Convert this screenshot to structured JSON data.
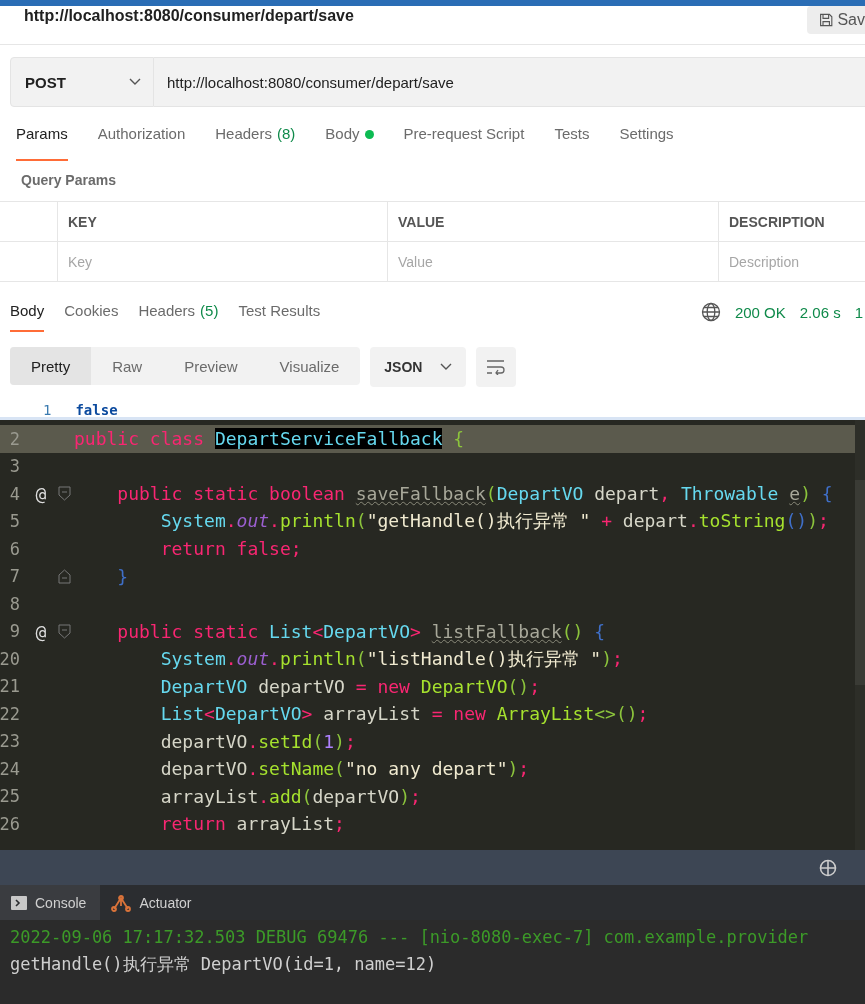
{
  "request": {
    "title": "http://localhost:8080/consumer/depart/save",
    "save_label": "Sav",
    "method": "POST",
    "url": "http://localhost:8080/consumer/depart/save",
    "tabs": [
      {
        "label": "Params",
        "selected": true,
        "dot": false
      },
      {
        "label": "Authorization",
        "selected": false,
        "dot": false
      },
      {
        "label": "Headers",
        "count": "(8)",
        "selected": false,
        "dot": false
      },
      {
        "label": "Body",
        "selected": false,
        "dot": true
      },
      {
        "label": "Pre-request Script",
        "selected": false,
        "dot": false
      },
      {
        "label": "Tests",
        "selected": false,
        "dot": false
      },
      {
        "label": "Settings",
        "selected": false,
        "dot": false
      }
    ],
    "section_title": "Query Params",
    "columns": [
      "KEY",
      "VALUE",
      "DESCRIPTION"
    ],
    "placeholders": [
      "Key",
      "Value",
      "Description"
    ]
  },
  "response": {
    "tabs": [
      {
        "label": "Body",
        "selected": true
      },
      {
        "label": "Cookies",
        "selected": false
      },
      {
        "label": "Headers",
        "count": "(5)",
        "selected": false
      },
      {
        "label": "Test Results",
        "selected": false
      }
    ],
    "status": "200 OK",
    "time": "2.06 s",
    "size": "1",
    "views": [
      {
        "label": "Pretty",
        "selected": true
      },
      {
        "label": "Raw",
        "selected": false
      },
      {
        "label": "Preview",
        "selected": false
      },
      {
        "label": "Visualize",
        "selected": false
      }
    ],
    "format": "JSON",
    "lines": [
      {
        "number": "1",
        "value": "false"
      }
    ]
  },
  "editor": {
    "lines": [
      {
        "number": "2",
        "current": true,
        "tokens": [
          {
            "kind": "kw",
            "text": "public class "
          },
          {
            "kind": "match",
            "text": "DepartServiceFallback"
          },
          {
            "kind": "paren",
            "text": " {"
          }
        ]
      },
      {
        "number": "3",
        "current": false
      },
      {
        "number": "4",
        "mark": "@",
        "fold": {
          "kind": "start"
        },
        "current": false,
        "tokens": [
          {
            "kind": "kw",
            "text": "    public static boolean "
          },
          {
            "kind": "unused",
            "text": "saveFallback"
          },
          {
            "kind": "paren",
            "text": "("
          },
          {
            "kind": "type",
            "text": "DepartVO"
          },
          {
            "kind": "plain",
            "text": " depart"
          },
          {
            "kind": "punct",
            "text": ", "
          },
          {
            "kind": "type",
            "text": "Throwable "
          },
          {
            "kind": "unused",
            "text": "e"
          },
          {
            "kind": "paren",
            "text": ")"
          },
          {
            "kind": "brace",
            "text": " {"
          }
        ]
      },
      {
        "number": "5",
        "current": false,
        "tokens": [
          {
            "kind": "type",
            "text": "        System"
          },
          {
            "kind": "punct",
            "text": "."
          },
          {
            "kind": "field",
            "text": "out"
          },
          {
            "kind": "punct",
            "text": "."
          },
          {
            "kind": "fn",
            "text": "println"
          },
          {
            "kind": "paren",
            "text": "("
          },
          {
            "kind": "str",
            "text": "\"getHandle()执行异常 \""
          },
          {
            "kind": "punct",
            "text": " + "
          },
          {
            "kind": "plain",
            "text": "depart"
          },
          {
            "kind": "punct",
            "text": "."
          },
          {
            "kind": "fn",
            "text": "toString"
          },
          {
            "kind": "brace",
            "text": "()"
          },
          {
            "kind": "paren",
            "text": ")"
          },
          {
            "kind": "punct",
            "text": ";"
          }
        ]
      },
      {
        "number": "6",
        "current": false,
        "tokens": [
          {
            "kind": "kw",
            "text": "        return false"
          },
          {
            "kind": "punct",
            "text": ";"
          }
        ]
      },
      {
        "number": "7",
        "fold": {
          "kind": "end"
        },
        "current": false,
        "tokens": [
          {
            "kind": "brace",
            "text": "    }"
          }
        ]
      },
      {
        "number": "8",
        "current": false
      },
      {
        "number": "9",
        "mark": "@",
        "fold": {
          "kind": "start"
        },
        "current": false,
        "tokens": [
          {
            "kind": "kw",
            "text": "    public static "
          },
          {
            "kind": "type",
            "text": "List"
          },
          {
            "kind": "punct",
            "text": "<"
          },
          {
            "kind": "type",
            "text": "DepartVO"
          },
          {
            "kind": "punct",
            "text": "> "
          },
          {
            "kind": "unused",
            "text": "listFallback"
          },
          {
            "kind": "paren",
            "text": "()"
          },
          {
            "kind": "brace",
            "text": " {"
          }
        ]
      },
      {
        "number": "20",
        "current": false,
        "tokens": [
          {
            "kind": "type",
            "text": "        System"
          },
          {
            "kind": "punct",
            "text": "."
          },
          {
            "kind": "field",
            "text": "out"
          },
          {
            "kind": "punct",
            "text": "."
          },
          {
            "kind": "fn",
            "text": "println"
          },
          {
            "kind": "paren",
            "text": "("
          },
          {
            "kind": "str",
            "text": "\"listHandle()执行异常 \""
          },
          {
            "kind": "paren",
            "text": ")"
          },
          {
            "kind": "punct",
            "text": ";"
          }
        ]
      },
      {
        "number": "21",
        "current": false,
        "tokens": [
          {
            "kind": "type",
            "text": "        DepartVO"
          },
          {
            "kind": "plain",
            "text": " departVO "
          },
          {
            "kind": "kw",
            "text": "= new "
          },
          {
            "kind": "fn",
            "text": "DepartVO"
          },
          {
            "kind": "paren",
            "text": "()"
          },
          {
            "kind": "punct",
            "text": ";"
          }
        ]
      },
      {
        "number": "22",
        "current": false,
        "tokens": [
          {
            "kind": "type",
            "text": "        List"
          },
          {
            "kind": "punct",
            "text": "<"
          },
          {
            "kind": "type",
            "text": "DepartVO"
          },
          {
            "kind": "punct",
            "text": ">"
          },
          {
            "kind": "plain",
            "text": " arrayList "
          },
          {
            "kind": "kw",
            "text": "= new "
          },
          {
            "kind": "fn",
            "text": "ArrayList"
          },
          {
            "kind": "paren",
            "text": "<>()"
          },
          {
            "kind": "punct",
            "text": ";"
          }
        ]
      },
      {
        "number": "23",
        "current": false,
        "tokens": [
          {
            "kind": "plain",
            "text": "        departVO"
          },
          {
            "kind": "punct",
            "text": "."
          },
          {
            "kind": "fn",
            "text": "setId"
          },
          {
            "kind": "paren",
            "text": "("
          },
          {
            "kind": "num",
            "text": "1"
          },
          {
            "kind": "paren",
            "text": ")"
          },
          {
            "kind": "punct",
            "text": ";"
          }
        ]
      },
      {
        "number": "24",
        "current": false,
        "tokens": [
          {
            "kind": "plain",
            "text": "        departVO"
          },
          {
            "kind": "punct",
            "text": "."
          },
          {
            "kind": "fn",
            "text": "setName"
          },
          {
            "kind": "paren",
            "text": "("
          },
          {
            "kind": "str",
            "text": "\"no any depart\""
          },
          {
            "kind": "paren",
            "text": ")"
          },
          {
            "kind": "punct",
            "text": ";"
          }
        ]
      },
      {
        "number": "25",
        "current": false,
        "tokens": [
          {
            "kind": "plain",
            "text": "        arrayList"
          },
          {
            "kind": "punct",
            "text": "."
          },
          {
            "kind": "fn",
            "text": "add"
          },
          {
            "kind": "paren",
            "text": "("
          },
          {
            "kind": "plain",
            "text": "departVO"
          },
          {
            "kind": "paren",
            "text": ")"
          },
          {
            "kind": "punct",
            "text": ";"
          }
        ]
      },
      {
        "number": "26",
        "current": false,
        "tokens": [
          {
            "kind": "kw",
            "text": "        return"
          },
          {
            "kind": "plain",
            "text": " arrayList"
          },
          {
            "kind": "punct",
            "text": ";"
          }
        ]
      }
    ]
  },
  "console": {
    "tabs": [
      {
        "label": "Console",
        "selected": true,
        "kind": "console"
      },
      {
        "label": "Actuator",
        "selected": false,
        "kind": "actuator"
      }
    ],
    "lines": [
      {
        "kind": "log",
        "text": "2022-09-06 17:17:32.503 DEBUG 69476 --- [nio-8080-exec-7] com.example.provider"
      },
      {
        "kind": "out",
        "text": "getHandle()执行异常 DepartVO(id=1, name=12)"
      }
    ]
  }
}
